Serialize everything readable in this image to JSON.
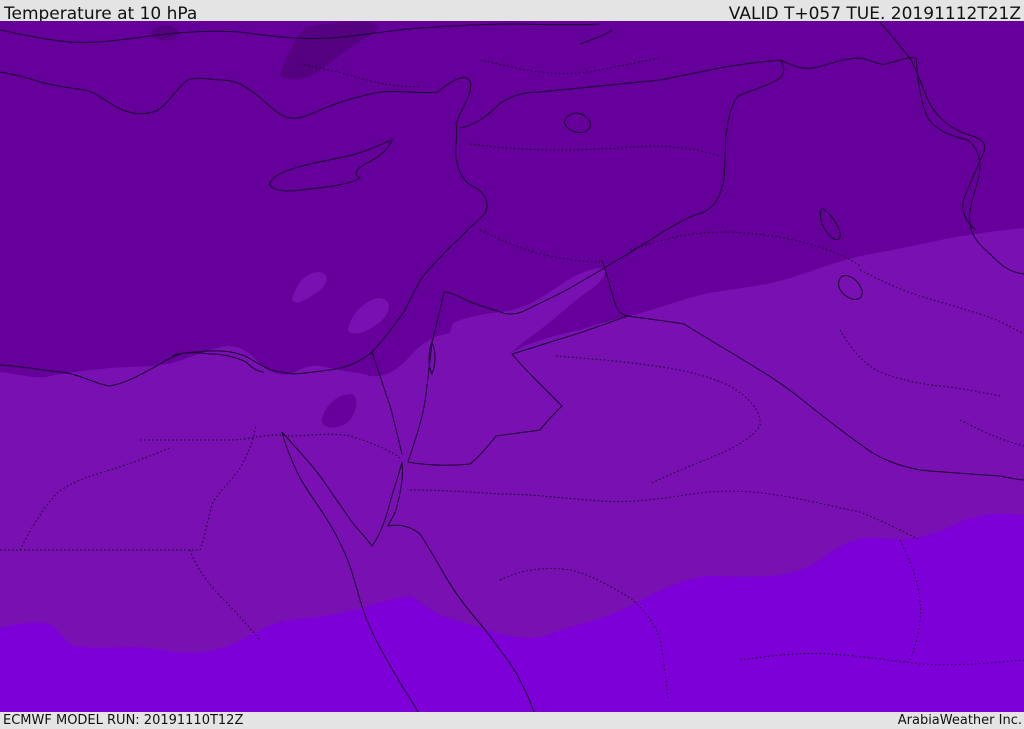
{
  "header": {
    "title": "Temperature at 10 hPa",
    "valid": "VALID T+057 TUE. 20191112T21Z"
  },
  "footer": {
    "model_run": "ECMWF MODEL RUN: 20191110T12Z",
    "credit": "ArabiaWeather Inc."
  },
  "colors": {
    "band_coldest": "#540080",
    "band_cold": "#65009a",
    "band_mid": "#7810b2",
    "band_warm": "#7e00d8",
    "lines": "#1a0030"
  }
}
